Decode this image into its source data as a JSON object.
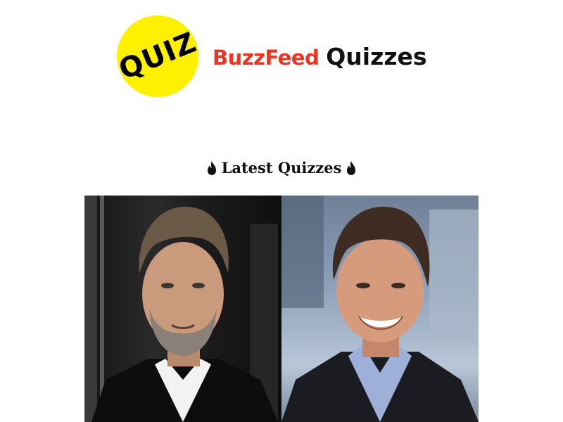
{
  "header": {
    "badge_text": "QUIZ",
    "brand_name": "BuzzFeed",
    "brand_suffix": "Quizzes"
  },
  "section": {
    "heading": "Latest Quizzes"
  },
  "colors": {
    "badge_yellow": "#fff000",
    "brand_red": "#ee3322",
    "text_dark": "#111111"
  },
  "icons": {
    "heading_left": "fire-icon",
    "heading_right": "fire-icon"
  }
}
